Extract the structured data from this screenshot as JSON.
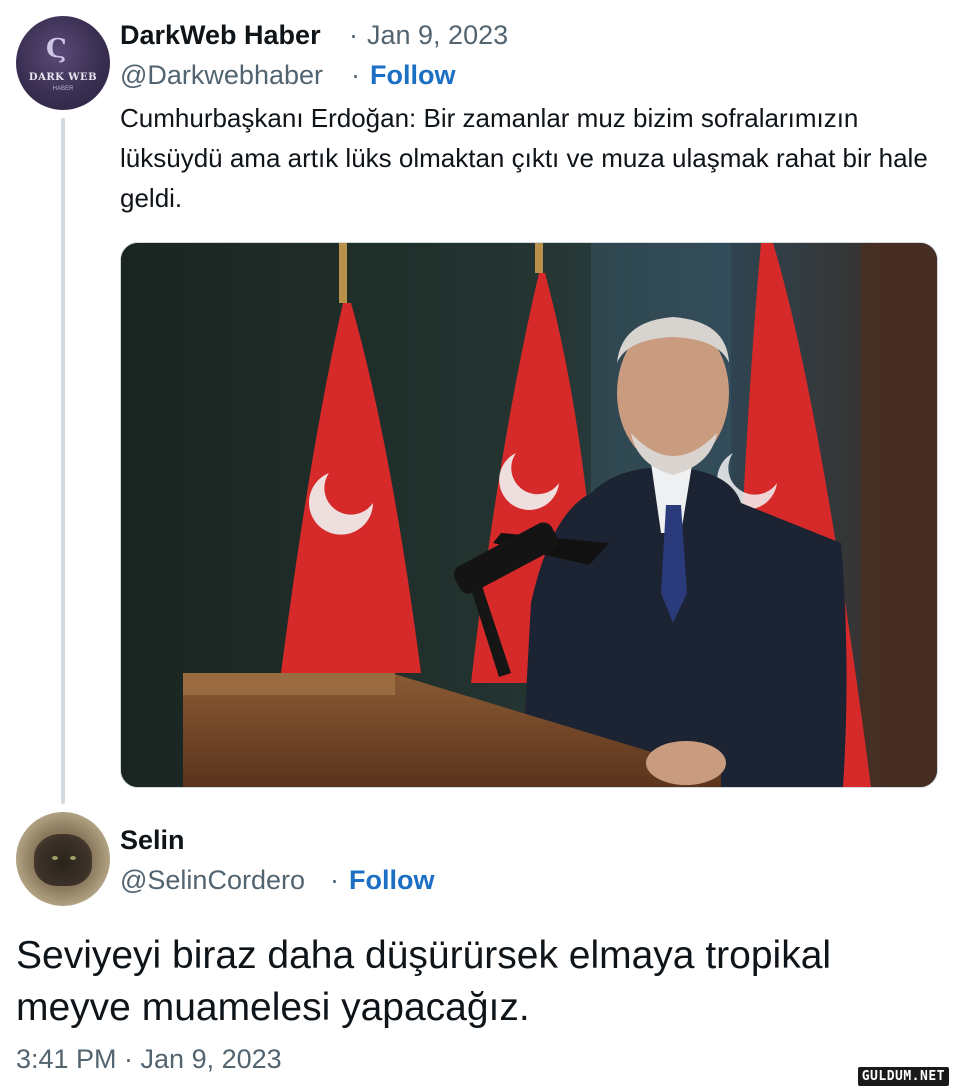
{
  "tweet": {
    "author_name": "DarkWeb Haber",
    "date": "Jan 9, 2023",
    "handle": "@Darkwebhaber",
    "follow_label": "Follow",
    "text": "Cumhurbaşkanı Erdoğan: Bir zamanlar muz bizim sofralarımızın lüksüydü ama artık lüks olmaktan çıktı ve muza ulaşmak rahat bir hale geldi.",
    "avatar_logo": "DARK WEB",
    "avatar_sub": "HABER"
  },
  "reply": {
    "author_name": "Selin",
    "handle": "@SelinCordero",
    "follow_label": "Follow",
    "text": "Seviyeyi biraz daha düşürürsek elmaya tropikal meyve muamelesi yapacağız.",
    "timestamp": "3:41 PM · Jan 9, 2023"
  },
  "watermark": "GULDUM.NET",
  "separator": "·",
  "colors": {
    "text": "#0f1419",
    "muted": "#536471",
    "follow": "#1d6fc4",
    "thread_line": "#cfd9de",
    "flag_red": "#d62a2a"
  }
}
